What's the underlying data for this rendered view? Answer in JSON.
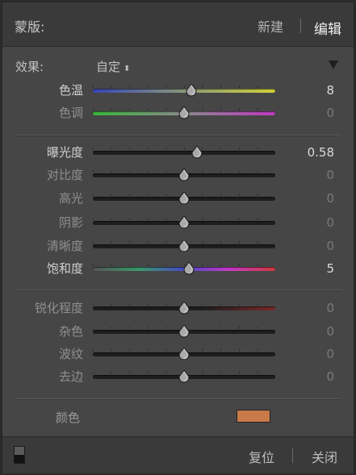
{
  "header": {
    "title": "蒙版:",
    "new_label": "新建",
    "edit_label": "编辑"
  },
  "effect": {
    "label": "效果:",
    "value": "自定",
    "updown_glyph": "⬍"
  },
  "groups": {
    "white_balance": [
      {
        "label": "色温",
        "value": "8",
        "position": 0.54,
        "gradient": "linear-gradient(90deg,#3a45b8,#8a9a7a,#d2d23a)",
        "dim": false
      },
      {
        "label": "色调",
        "value": "0",
        "position": 0.5,
        "gradient": "linear-gradient(90deg,#3ab83a,#8a8a8a,#c23ac2)",
        "dim": true
      }
    ],
    "tone": [
      {
        "label": "曝光度",
        "value": "0.58",
        "position": 0.57,
        "dim": false
      },
      {
        "label": "对比度",
        "value": "0",
        "position": 0.5,
        "dim": true
      },
      {
        "label": "高光",
        "value": "0",
        "position": 0.5,
        "dim": true
      },
      {
        "label": "阴影",
        "value": "0",
        "position": 0.5,
        "dim": true
      },
      {
        "label": "清晰度",
        "value": "0",
        "position": 0.5,
        "dim": true
      },
      {
        "label": "饱和度",
        "value": "5",
        "position": 0.525,
        "gradient": "linear-gradient(90deg,#555,#3a9a6a,#4a4ac8,#c83ac8,#d23a3a)",
        "dim": false
      }
    ],
    "detail": [
      {
        "label": "锐化程度",
        "value": "0",
        "position": 0.5,
        "gradient": "linear-gradient(90deg,#1e1e1e 60%,#7a2a2a)",
        "dim": true
      },
      {
        "label": "杂色",
        "value": "0",
        "position": 0.5,
        "dim": true
      },
      {
        "label": "波纹",
        "value": "0",
        "position": 0.5,
        "dim": true
      },
      {
        "label": "去边",
        "value": "0",
        "position": 0.5,
        "dim": true
      }
    ]
  },
  "color": {
    "label": "颜色",
    "swatch": "#c87a48"
  },
  "footer": {
    "reset_label": "复位",
    "close_label": "关闭"
  }
}
